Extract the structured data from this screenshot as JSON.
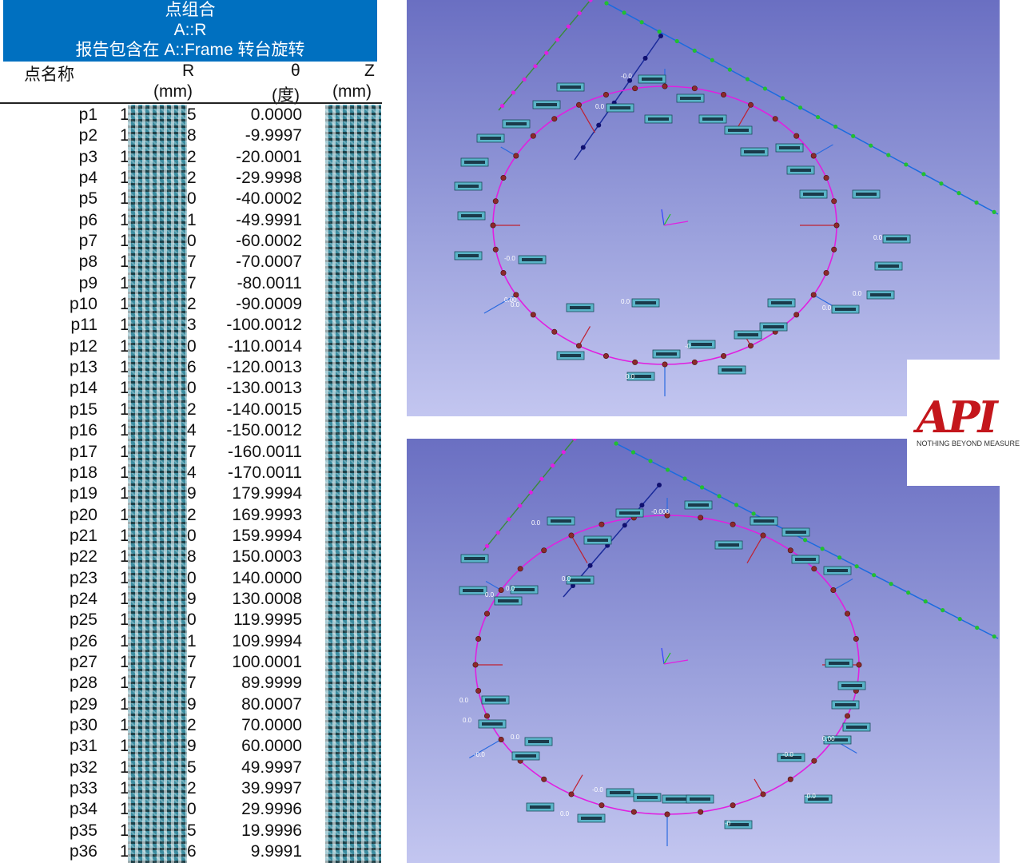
{
  "report": {
    "title": "点组合",
    "subtitle": "A::R",
    "caption": "报告包含在 A::Frame 转台旋转",
    "columns": {
      "name": "点名称",
      "r": "R",
      "r_unit": "(mm)",
      "theta": "θ",
      "theta_unit": "(度)",
      "z": "Z",
      "z_unit": "(mm)"
    },
    "rows": [
      {
        "name": "p1",
        "r_lead": "1",
        "r_tail": "5",
        "theta": "0.0000"
      },
      {
        "name": "p2",
        "r_lead": "1",
        "r_tail": "8",
        "theta": "-9.9997"
      },
      {
        "name": "p3",
        "r_lead": "1",
        "r_tail": "2",
        "theta": "-20.0001"
      },
      {
        "name": "p4",
        "r_lead": "1",
        "r_tail": "2",
        "theta": "-29.9998"
      },
      {
        "name": "p5",
        "r_lead": "1",
        "r_tail": "0",
        "theta": "-40.0002"
      },
      {
        "name": "p6",
        "r_lead": "1",
        "r_tail": "1",
        "theta": "-49.9991"
      },
      {
        "name": "p7",
        "r_lead": "1",
        "r_tail": "0",
        "theta": "-60.0002"
      },
      {
        "name": "p8",
        "r_lead": "1",
        "r_tail": "7",
        "theta": "-70.0007"
      },
      {
        "name": "p9",
        "r_lead": "1",
        "r_tail": "7",
        "theta": "-80.0011"
      },
      {
        "name": "p10",
        "r_lead": "1",
        "r_tail": "2",
        "theta": "-90.0009"
      },
      {
        "name": "p11",
        "r_lead": "1",
        "r_tail": "3",
        "theta": "-100.0012"
      },
      {
        "name": "p12",
        "r_lead": "1",
        "r_tail": "0",
        "theta": "-110.0014"
      },
      {
        "name": "p13",
        "r_lead": "1",
        "r_tail": "6",
        "theta": "-120.0013"
      },
      {
        "name": "p14",
        "r_lead": "1",
        "r_tail": "0",
        "theta": "-130.0013"
      },
      {
        "name": "p15",
        "r_lead": "1",
        "r_tail": "2",
        "theta": "-140.0015"
      },
      {
        "name": "p16",
        "r_lead": "1",
        "r_tail": "4",
        "theta": "-150.0012"
      },
      {
        "name": "p17",
        "r_lead": "1",
        "r_tail": "7",
        "theta": "-160.0011"
      },
      {
        "name": "p18",
        "r_lead": "1",
        "r_tail": "4",
        "theta": "-170.0011"
      },
      {
        "name": "p19",
        "r_lead": "1",
        "r_tail": "9",
        "theta": "179.9994"
      },
      {
        "name": "p20",
        "r_lead": "1",
        "r_tail": "2",
        "theta": "169.9993"
      },
      {
        "name": "p21",
        "r_lead": "1",
        "r_tail": "0",
        "theta": "159.9994"
      },
      {
        "name": "p22",
        "r_lead": "1",
        "r_tail": "8",
        "theta": "150.0003"
      },
      {
        "name": "p23",
        "r_lead": "1",
        "r_tail": "0",
        "theta": "140.0000"
      },
      {
        "name": "p24",
        "r_lead": "1",
        "r_tail": "9",
        "theta": "130.0008"
      },
      {
        "name": "p25",
        "r_lead": "1",
        "r_tail": "0",
        "theta": "119.9995"
      },
      {
        "name": "p26",
        "r_lead": "1",
        "r_tail": "1",
        "theta": "109.9994"
      },
      {
        "name": "p27",
        "r_lead": "1",
        "r_tail": "7",
        "theta": "100.0001"
      },
      {
        "name": "p28",
        "r_lead": "1",
        "r_tail": "7",
        "theta": "89.9999"
      },
      {
        "name": "p29",
        "r_lead": "1",
        "r_tail": "9",
        "theta": "80.0007"
      },
      {
        "name": "p30",
        "r_lead": "1",
        "r_tail": "2",
        "theta": "70.0000"
      },
      {
        "name": "p31",
        "r_lead": "1",
        "r_tail": "9",
        "theta": "60.0000"
      },
      {
        "name": "p32",
        "r_lead": "1",
        "r_tail": "5",
        "theta": "49.9997"
      },
      {
        "name": "p33",
        "r_lead": "1",
        "r_tail": "2",
        "theta": "39.9997"
      },
      {
        "name": "p34",
        "r_lead": "1",
        "r_tail": "0",
        "theta": "29.9996"
      },
      {
        "name": "p35",
        "r_lead": "1",
        "r_tail": "5",
        "theta": "19.9996"
      },
      {
        "name": "p36",
        "r_lead": "1",
        "r_tail": "6",
        "theta": "9.9991"
      }
    ]
  },
  "viewports": {
    "top": {
      "labels": [
        "0.0",
        "-0.0",
        "-0.0",
        "0.0",
        "0.0",
        "0.00",
        "0.0",
        "-0",
        "0.0",
        "0.0",
        "0.0"
      ]
    },
    "bottom": {
      "labels": [
        "-0.000",
        "0.0",
        "0.0",
        "0.0",
        "0.0",
        "0.0",
        "0.0",
        "-0.0",
        "0.00",
        "-0.0",
        "0.0",
        "-0.0",
        "-0.0",
        "0.0",
        "-0"
      ]
    }
  },
  "colors": {
    "header_bg": "#0070c0",
    "circle": "#e020e0",
    "line_blue": "#1a6be0",
    "line_green": "#20c030",
    "marker": "#8b2a2a",
    "logo_red": "#c4161c"
  },
  "logo": {
    "mark": "API",
    "tagline": "NOTHING BEYOND MEASURE"
  }
}
